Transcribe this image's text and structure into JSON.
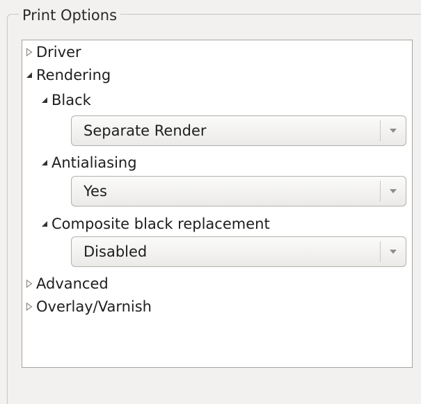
{
  "panel": {
    "title": "Print Options"
  },
  "tree": {
    "driver": {
      "label": "Driver",
      "expanded": false
    },
    "rendering": {
      "label": "Rendering",
      "expanded": true
    },
    "black": {
      "label": "Black",
      "expanded": true,
      "value": "Separate Render"
    },
    "antialiasing": {
      "label": "Antialiasing",
      "expanded": true,
      "value": "Yes"
    },
    "composite": {
      "label": "Composite black replacement",
      "expanded": true,
      "value": "Disabled"
    },
    "advanced": {
      "label": "Advanced",
      "expanded": false
    },
    "overlay": {
      "label": "Overlay/Varnish",
      "expanded": false
    }
  },
  "icons": {
    "collapsed": "expander-collapsed-icon",
    "expanded": "expander-expanded-icon",
    "dropdown": "chevron-down-icon"
  }
}
